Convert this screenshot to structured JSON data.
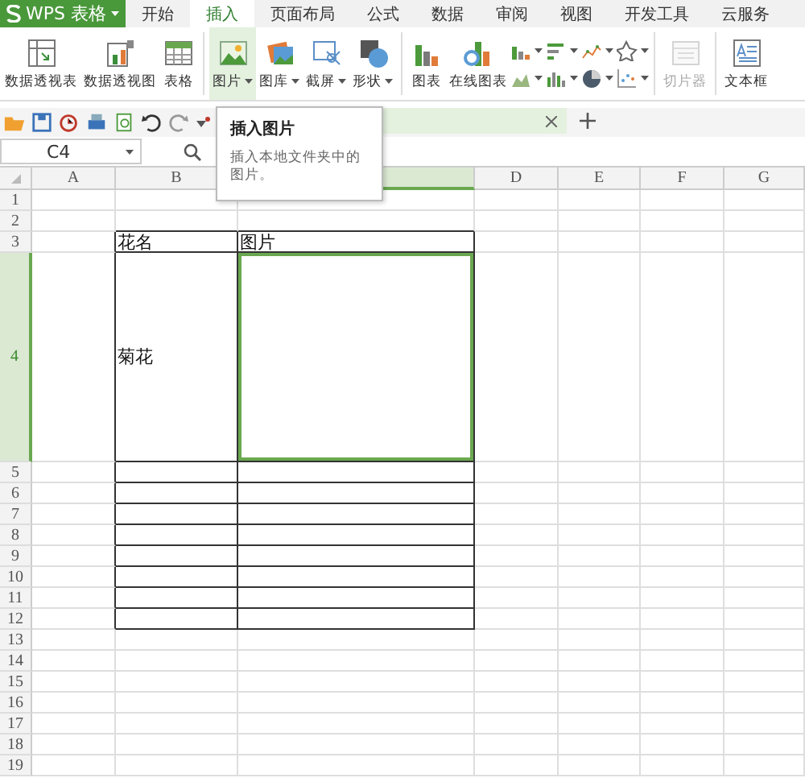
{
  "app": {
    "name": "WPS 表格"
  },
  "menu_tabs": [
    {
      "label": "开始",
      "selected": false
    },
    {
      "label": "插入",
      "selected": true
    },
    {
      "label": "页面布局",
      "selected": false
    },
    {
      "label": "公式",
      "selected": false
    },
    {
      "label": "数据",
      "selected": false
    },
    {
      "label": "审阅",
      "selected": false
    },
    {
      "label": "视图",
      "selected": false
    },
    {
      "label": "开发工具",
      "selected": false
    },
    {
      "label": "云服务",
      "selected": false
    }
  ],
  "ribbon": [
    {
      "kind": "large",
      "label": "数据透视表",
      "dropdown": false,
      "disabled": false,
      "hovered": false
    },
    {
      "kind": "large",
      "label": "数据透视图",
      "dropdown": false,
      "disabled": false,
      "hovered": false
    },
    {
      "kind": "large",
      "label": "表格",
      "dropdown": false,
      "disabled": false,
      "hovered": false
    },
    {
      "kind": "separator"
    },
    {
      "kind": "large",
      "label": "图片",
      "dropdown": true,
      "disabled": false,
      "hovered": true
    },
    {
      "kind": "large",
      "label": "图库",
      "dropdown": true,
      "disabled": false,
      "hovered": false
    },
    {
      "kind": "large",
      "label": "截屏",
      "dropdown": true,
      "disabled": false,
      "hovered": false
    },
    {
      "kind": "large",
      "label": "形状",
      "dropdown": true,
      "disabled": false,
      "hovered": false
    },
    {
      "kind": "separator"
    },
    {
      "kind": "large",
      "label": "图表",
      "dropdown": false,
      "disabled": false,
      "hovered": false
    },
    {
      "kind": "large",
      "label": "在线图表",
      "dropdown": false,
      "disabled": false,
      "hovered": false
    },
    {
      "kind": "chart_grid"
    },
    {
      "kind": "separator"
    },
    {
      "kind": "large",
      "label": "切片器",
      "dropdown": false,
      "disabled": true,
      "hovered": false
    },
    {
      "kind": "separator"
    },
    {
      "kind": "large",
      "label": "文本框",
      "dropdown": false,
      "disabled": false,
      "hovered": false
    }
  ],
  "flower_table": {
    "header": [
      {
        "text": "花名",
        "selected": false
      },
      {
        "text": "图片",
        "selected": false
      }
    ],
    "rows": [
      {
        "cells": [
          {
            "text": "菊花",
            "selected": false
          },
          {
            "selected": true
          }
        ]
      }
    ]
  },
  "tooltip": {
    "title": "插入图片",
    "text": "插入本地文件夹中的图片。"
  },
  "name_box": {
    "value": "C4"
  },
  "columns": [
    {
      "label": "A",
      "selected": false
    },
    {
      "label": "B",
      "selected": false
    },
    {
      "selected": true
    },
    {
      "label": "D",
      "selected": false
    },
    {
      "label": "E",
      "selected": false
    },
    {
      "label": "F",
      "selected": false
    },
    {
      "label": "G",
      "selected": false
    }
  ],
  "rows": [
    {
      "label": "1",
      "selected": false
    },
    {
      "label": "2",
      "selected": false
    },
    {
      "label": "3",
      "selected": false
    },
    {
      "label": "4",
      "selected": true
    },
    {
      "label": "5",
      "selected": false
    },
    {
      "label": "6",
      "selected": false
    },
    {
      "label": "7",
      "selected": false
    },
    {
      "label": "8",
      "selected": false
    },
    {
      "label": "9",
      "selected": false
    },
    {
      "label": "10",
      "selected": false
    },
    {
      "label": "11",
      "selected": false
    },
    {
      "label": "12",
      "selected": false
    },
    {
      "label": "13",
      "selected": false
    },
    {
      "label": "14",
      "selected": false
    },
    {
      "label": "15",
      "selected": false
    },
    {
      "label": "16",
      "selected": false
    },
    {
      "label": "17",
      "selected": false
    },
    {
      "label": "18",
      "selected": false
    },
    {
      "label": "19",
      "selected": false
    }
  ]
}
